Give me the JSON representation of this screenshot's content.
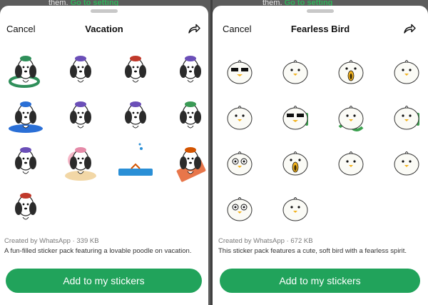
{
  "background_text": {
    "prefix": "them.",
    "link": "Go to setting"
  },
  "colors": {
    "accent_green": "#21a35b",
    "link_green": "#30b45a",
    "backdrop": "#5c5c5c"
  },
  "sheets": [
    {
      "cancel_label": "Cancel",
      "title": "Vacation",
      "share_icon": "share-forward-icon",
      "creator": "Created by WhatsApp · 339 KB",
      "description": "A fun-filled sticker pack featuring a lovable poodle on vacation.",
      "button_label": "Add to my stickers",
      "sticker_count": 13,
      "sticker_subject": "poodle"
    },
    {
      "cancel_label": "Cancel",
      "title": "Fearless Bird",
      "share_icon": "share-forward-icon",
      "creator": "Created by WhatsApp · 672 KB",
      "description": "This sticker pack features a cute, soft bird with a fearless spirit.",
      "button_label": "Add to my stickers",
      "sticker_count": 14,
      "sticker_subject": "bird"
    }
  ]
}
